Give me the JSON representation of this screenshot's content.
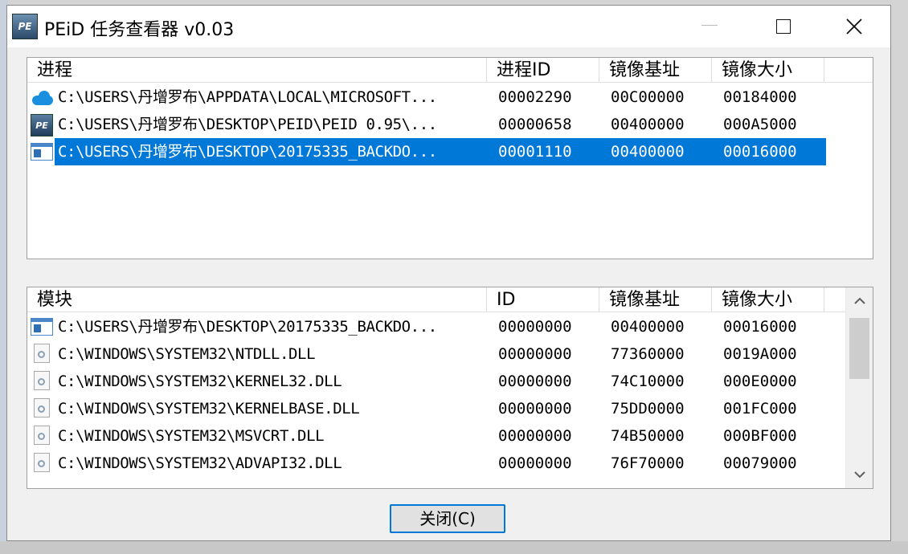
{
  "window": {
    "title": "PEiD 任务查看器 v0.03"
  },
  "icons": {
    "app": "peid-app-icon",
    "minimize": "minimize-icon",
    "maximize": "maximize-icon",
    "close": "close-icon"
  },
  "process_list": {
    "columns": [
      "进程",
      "进程ID",
      "镜像基址",
      "镜像大小"
    ],
    "rows": [
      {
        "icon": "onedrive-cloud-icon",
        "path": "C:\\USERS\\丹增罗布\\APPDATA\\LOCAL\\MICROSOFT...",
        "id": "00002290",
        "base": "00C00000",
        "size": "00184000",
        "selected": false
      },
      {
        "icon": "peid-icon",
        "path": "C:\\USERS\\丹增罗布\\DESKTOP\\PEID\\PEID 0.95\\...",
        "id": "00000658",
        "base": "00400000",
        "size": "000A5000",
        "selected": false
      },
      {
        "icon": "application-window-icon",
        "path": "C:\\USERS\\丹增罗布\\DESKTOP\\20175335_BACKDO...",
        "id": "00001110",
        "base": "00400000",
        "size": "00016000",
        "selected": true
      }
    ]
  },
  "module_list": {
    "columns": [
      "模块",
      "ID",
      "镜像基址",
      "镜像大小"
    ],
    "rows": [
      {
        "icon": "application-window-icon",
        "path": "C:\\USERS\\丹增罗布\\DESKTOP\\20175335_BACKDO...",
        "id": "00000000",
        "base": "00400000",
        "size": "00016000"
      },
      {
        "icon": "dll-file-icon",
        "path": "C:\\WINDOWS\\SYSTEM32\\NTDLL.DLL",
        "id": "00000000",
        "base": "77360000",
        "size": "0019A000"
      },
      {
        "icon": "dll-file-icon",
        "path": "C:\\WINDOWS\\SYSTEM32\\KERNEL32.DLL",
        "id": "00000000",
        "base": "74C10000",
        "size": "000E0000"
      },
      {
        "icon": "dll-file-icon",
        "path": "C:\\WINDOWS\\SYSTEM32\\KERNELBASE.DLL",
        "id": "00000000",
        "base": "75DD0000",
        "size": "001FC000"
      },
      {
        "icon": "dll-file-icon",
        "path": "C:\\WINDOWS\\SYSTEM32\\MSVCRT.DLL",
        "id": "00000000",
        "base": "74B50000",
        "size": "000BF000"
      },
      {
        "icon": "dll-file-icon",
        "path": "C:\\WINDOWS\\SYSTEM32\\ADVAPI32.DLL",
        "id": "00000000",
        "base": "76F70000",
        "size": "00079000"
      }
    ]
  },
  "buttons": {
    "close_label": "关闭(C)"
  },
  "colors": {
    "selection": "#0078d7",
    "window_bg": "#f0f0f0"
  }
}
